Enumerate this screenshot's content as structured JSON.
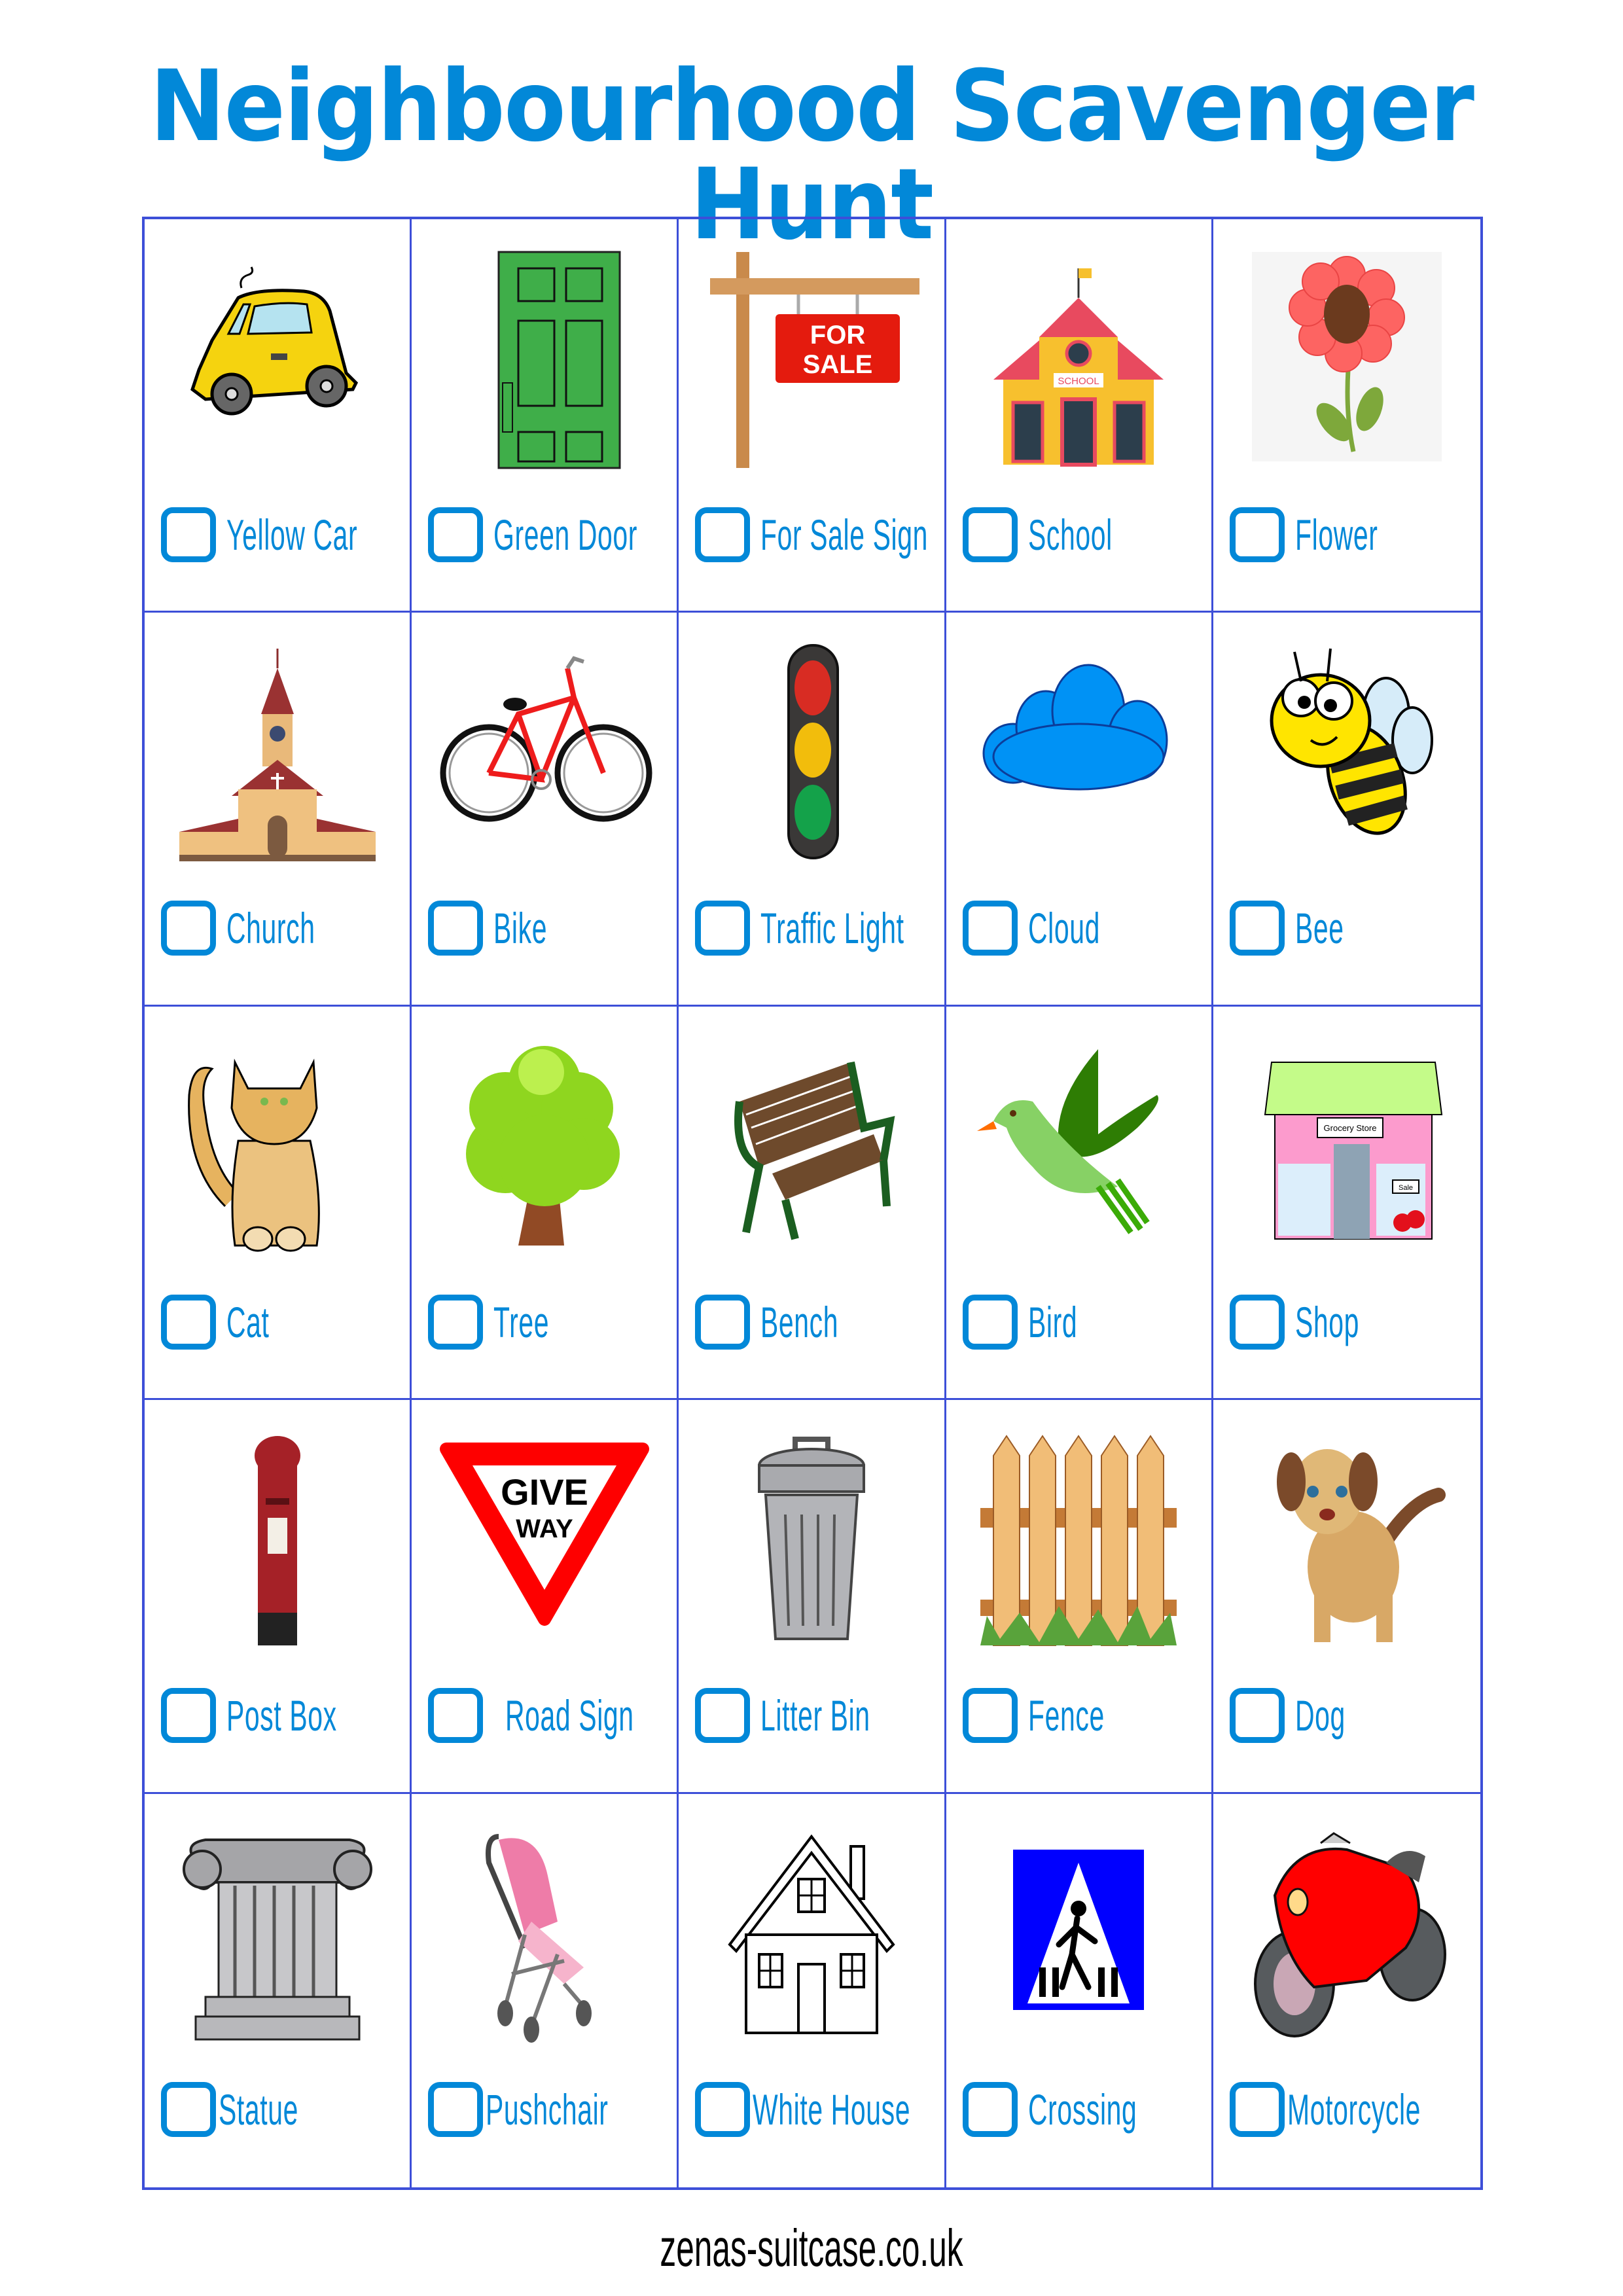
{
  "title": "Neighbourhood Scavenger Hunt",
  "footer": "zenas-suitcase.co.uk",
  "colors": {
    "accent": "#0288d8",
    "grid": "#3d4fd8",
    "footer_text": "#000000"
  },
  "items": [
    {
      "label": "Yellow Car",
      "icon": "yellow-car",
      "checked": false
    },
    {
      "label": "Green Door",
      "icon": "green-door",
      "checked": false
    },
    {
      "label": "For Sale Sign",
      "icon": "for-sale-sign",
      "checked": false
    },
    {
      "label": "School",
      "icon": "school",
      "checked": false
    },
    {
      "label": "Flower",
      "icon": "flower",
      "checked": false
    },
    {
      "label": "Church",
      "icon": "church",
      "checked": false
    },
    {
      "label": "Bike",
      "icon": "bike",
      "checked": false
    },
    {
      "label": "Traffic Light",
      "icon": "traffic-light",
      "checked": false
    },
    {
      "label": "Cloud",
      "icon": "cloud",
      "checked": false
    },
    {
      "label": "Bee",
      "icon": "bee",
      "checked": false
    },
    {
      "label": "Cat",
      "icon": "cat",
      "checked": false
    },
    {
      "label": "Tree",
      "icon": "tree",
      "checked": false
    },
    {
      "label": "Bench",
      "icon": "bench",
      "checked": false
    },
    {
      "label": "Bird",
      "icon": "bird",
      "checked": false
    },
    {
      "label": "Shop",
      "icon": "shop",
      "checked": false
    },
    {
      "label": "Post Box",
      "icon": "post-box",
      "checked": false
    },
    {
      "label": "Road Sign",
      "icon": "road-sign",
      "checked": false
    },
    {
      "label": "Litter Bin",
      "icon": "litter-bin",
      "checked": false
    },
    {
      "label": "Fence",
      "icon": "fence",
      "checked": false
    },
    {
      "label": "Dog",
      "icon": "dog",
      "checked": false
    },
    {
      "label": "Statue",
      "icon": "statue",
      "checked": false
    },
    {
      "label": "Pushchair",
      "icon": "pushchair",
      "checked": false
    },
    {
      "label": "White House",
      "icon": "white-house",
      "checked": false
    },
    {
      "label": "Crossing",
      "icon": "crossing",
      "checked": false
    },
    {
      "label": "Motorcycle",
      "icon": "motorcycle",
      "checked": false
    }
  ],
  "image_text": {
    "for_sale_sign": [
      "FOR",
      "SALE"
    ],
    "school_sign": "SCHOOL",
    "shop_sign": "Grocery Store",
    "shop_sale": "Sale",
    "road_sign": [
      "GIVE",
      "WAY"
    ]
  }
}
